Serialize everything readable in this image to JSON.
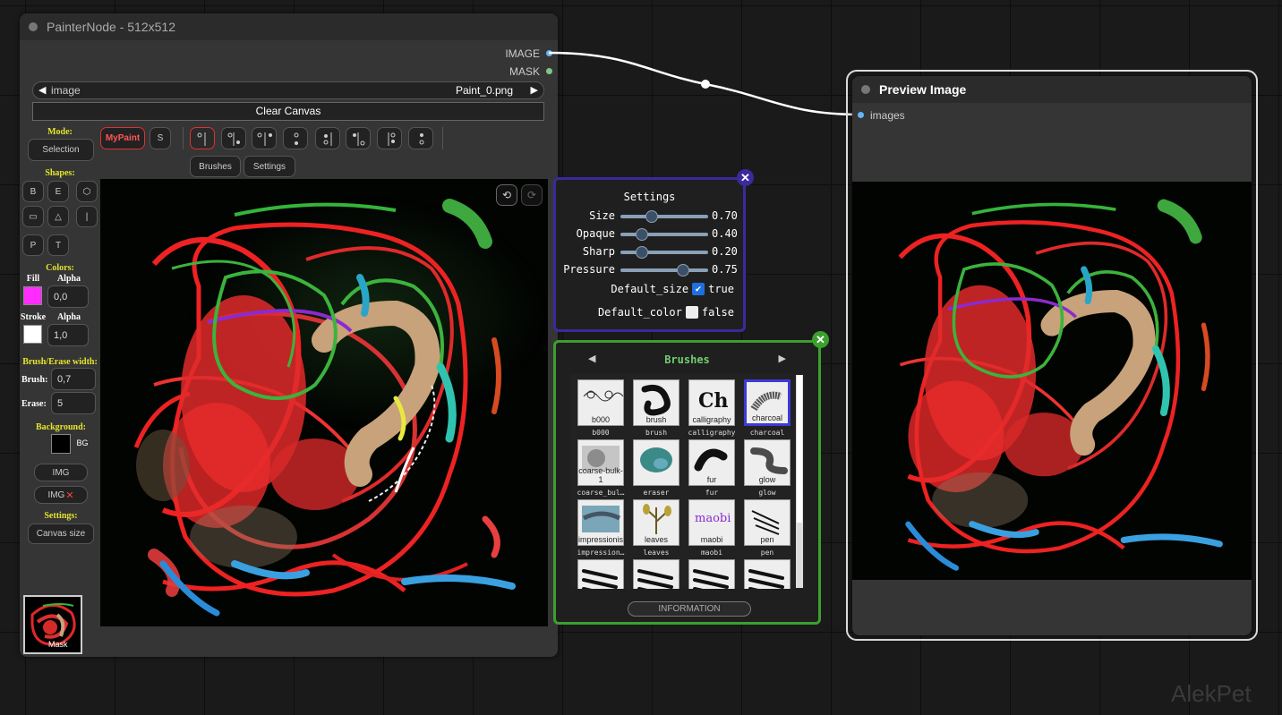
{
  "painter_node": {
    "title": "PainterNode - 512x512",
    "outputs": {
      "image": "IMAGE",
      "mask": "MASK"
    },
    "image_widget": {
      "label": "image",
      "value": "Paint_0.png",
      "prev": "◀",
      "next": "▶"
    },
    "clear_label": "Clear Canvas",
    "mode": {
      "title": "Mode:",
      "selection": "Selection",
      "mypaint": "MyPaint",
      "s": "S"
    },
    "shapes": {
      "title": "Shapes:",
      "items": [
        "B",
        "E",
        "⬡",
        "▭",
        "△",
        "|",
        "P",
        "T"
      ]
    },
    "colors": {
      "title": "Colors:",
      "fill": {
        "label": "Fill",
        "alpha_label": "Alpha",
        "alpha": "0,0",
        "color": "#ff2bff"
      },
      "stroke": {
        "label": "Stroke",
        "alpha_label": "Alpha",
        "alpha": "1,0",
        "color": "#ffffff"
      }
    },
    "widths": {
      "title": "Brush/Erase width:",
      "brush_label": "Brush:",
      "brush": "0,7",
      "erase_label": "Erase:",
      "erase": "5"
    },
    "background": {
      "title": "Background:",
      "label": "BG",
      "color": "#000000"
    },
    "img_button": "IMG",
    "img_remove_button": "IMG",
    "settings": {
      "title": "Settings:",
      "canvas_size": "Canvas size"
    },
    "tabs": {
      "brushes": "Brushes",
      "settings": "Settings"
    },
    "mask_label": "Mask"
  },
  "settings_panel": {
    "title": "Settings",
    "sliders": [
      {
        "label": "Size",
        "value": "0.70",
        "level": 0.33
      },
      {
        "label": "Opaque",
        "value": "0.40",
        "level": 0.2
      },
      {
        "label": "Sharp",
        "value": "0.20",
        "level": 0.2
      },
      {
        "label": "Pressure",
        "value": "0.75",
        "level": 0.75
      }
    ],
    "default_size": {
      "label": "Default_size",
      "value": "true"
    },
    "default_color": {
      "label": "Default_color",
      "value": "false"
    },
    "accent": "#3a2a9c"
  },
  "brushes_panel": {
    "title": "Brushes",
    "prev": "◀",
    "next": "▶",
    "accent": "#3ba02d",
    "info_label": "INFORMATION",
    "brushes": [
      {
        "name": "b000",
        "tile_label": "b000"
      },
      {
        "name": "brush",
        "tile_label": "brush"
      },
      {
        "name": "calligraphy",
        "tile_label": "calligraphy"
      },
      {
        "name": "charcoal",
        "tile_label": "charcoal",
        "selected": true
      },
      {
        "name": "coarse_bul…",
        "tile_label": "coarse-bulk-1"
      },
      {
        "name": "eraser",
        "tile_label": ""
      },
      {
        "name": "fur",
        "tile_label": "fur"
      },
      {
        "name": "glow",
        "tile_label": "glow"
      },
      {
        "name": "impression…",
        "tile_label": "impressionism"
      },
      {
        "name": "leaves",
        "tile_label": "leaves"
      },
      {
        "name": "maobi",
        "tile_label": "maobi"
      },
      {
        "name": "pen",
        "tile_label": "pen"
      },
      {
        "name": "",
        "tile_label": ""
      },
      {
        "name": "",
        "tile_label": ""
      },
      {
        "name": "",
        "tile_label": ""
      },
      {
        "name": "",
        "tile_label": ""
      }
    ]
  },
  "preview_node": {
    "title": "Preview Image",
    "input": "images"
  },
  "watermark": "AlekPet"
}
